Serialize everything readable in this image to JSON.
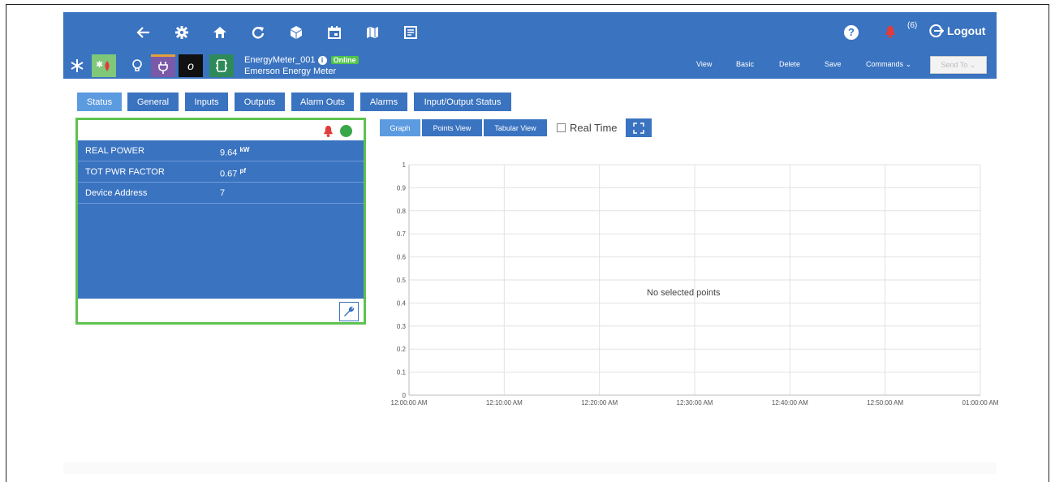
{
  "topbar": {
    "nav_icons": [
      "back-arrow-icon",
      "gear-icon",
      "home-icon",
      "refresh-icon",
      "cube-icon",
      "calendar-icon",
      "map-icon",
      "report-icon"
    ],
    "help": "?",
    "notifications": "(6)",
    "logout": "Logout"
  },
  "device": {
    "name": "EnergyMeter_001",
    "status": "Online",
    "type": "Emerson Energy Meter",
    "tiles": [
      "snowflake-icon",
      "fan-heat-icon",
      "bulb-icon",
      "plug-icon",
      "italic-o-icon",
      "meter-icon"
    ]
  },
  "actions": {
    "view": "View",
    "basic": "Basic",
    "delete": "Delete",
    "save": "Save",
    "commands": "Commands ⌄",
    "send_to": "Send To ⌄"
  },
  "tabs": [
    "Status",
    "General",
    "Inputs",
    "Outputs",
    "Alarm Outs",
    "Alarms",
    "Input/Output Status"
  ],
  "status_panel": {
    "rows": [
      {
        "label": "REAL POWER",
        "value": "9.64",
        "unit": "kW"
      },
      {
        "label": "TOT PWR FACTOR",
        "value": "0.67",
        "unit": "pf"
      },
      {
        "label": "Device Address",
        "value": "7",
        "unit": ""
      }
    ]
  },
  "graph_controls": {
    "graph": "Graph",
    "points_view": "Points View",
    "tabular_view": "Tabular View",
    "real_time": "Real Time"
  },
  "chart_data": {
    "type": "line",
    "title": "",
    "xlabel": "",
    "ylabel": "",
    "message": "No selected points",
    "y_ticks": [
      "0",
      "0.1",
      "0.2",
      "0.3",
      "0.4",
      "0.5",
      "0.6",
      "0.7",
      "0.8",
      "0.9",
      "1"
    ],
    "x_ticks": [
      "12:00:00 AM",
      "12:10:00 AM",
      "12:20:00 AM",
      "12:30:00 AM",
      "12:40:00 AM",
      "12:50:00 AM",
      "01:00:00 AM"
    ],
    "ylim": [
      0,
      1
    ],
    "grid": true,
    "series": []
  },
  "colors": {
    "primary": "#3a73c0",
    "active": "#5d9be0",
    "online": "#4fc24c",
    "alarm": "#e23b3b",
    "panel_border": "#5ec24f"
  }
}
